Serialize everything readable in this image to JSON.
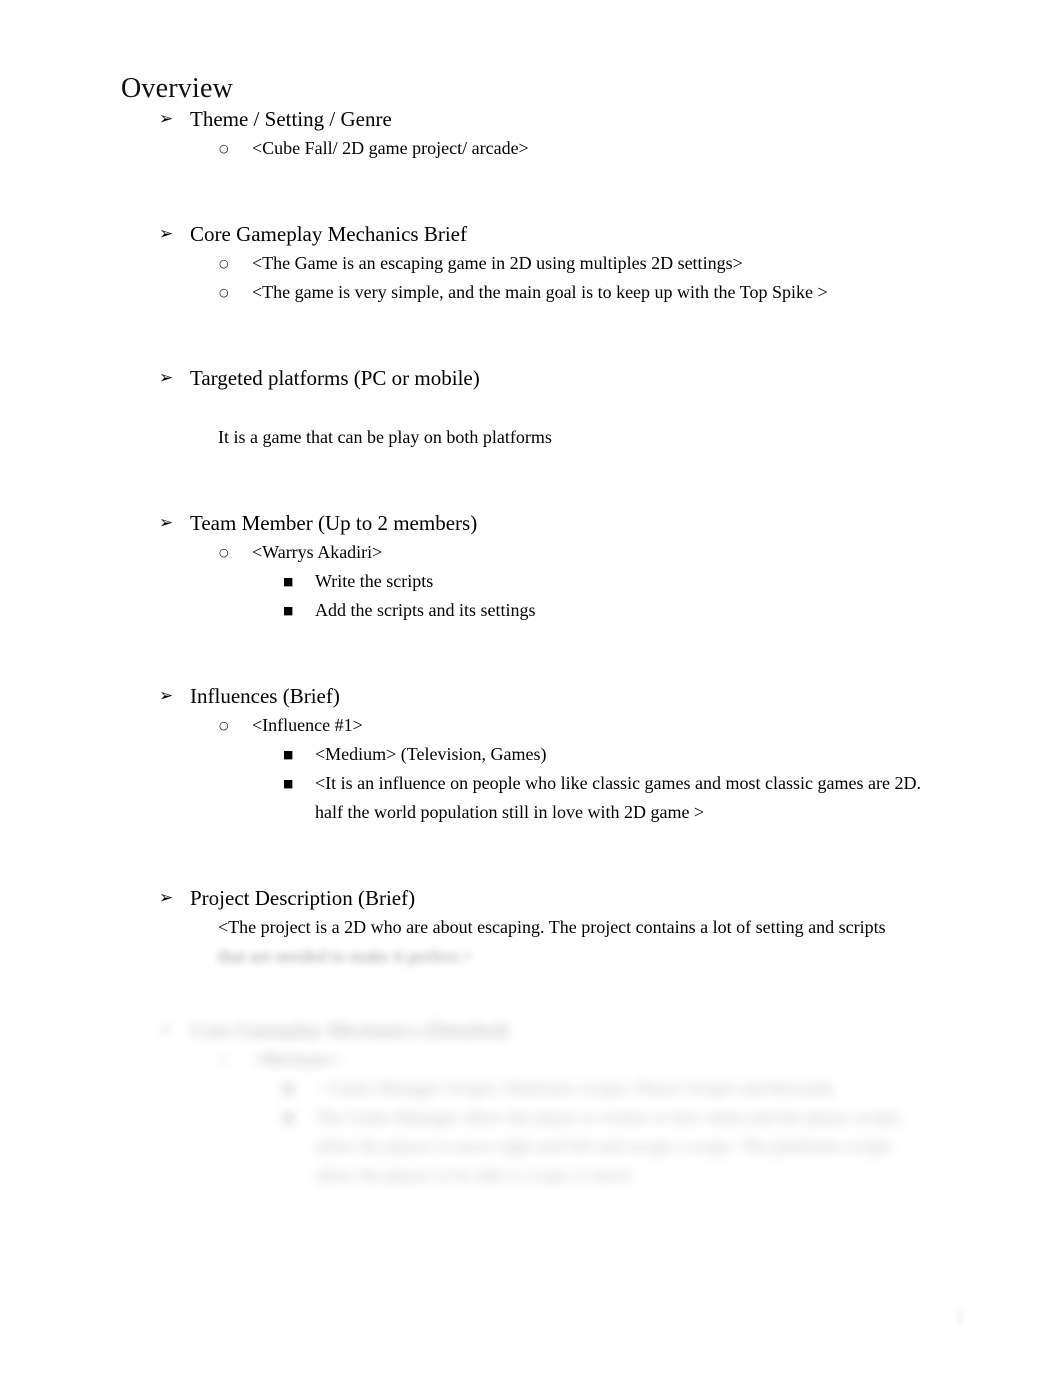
{
  "document": {
    "title": "Overview",
    "page_number": "1",
    "bullet_glyphs": {
      "level1": "➢",
      "level2": "○",
      "level3": "■"
    },
    "sections": [
      {
        "heading": "Theme / Setting / Genre",
        "items": [
          {
            "level": 2,
            "text": "<Cube Fall/ 2D game project/ arcade>"
          }
        ]
      },
      {
        "heading": "Core Gameplay Mechanics Brief",
        "items": [
          {
            "level": 2,
            "text": "<The Game is an escaping game in 2D using multiples 2D settings>"
          },
          {
            "level": 2,
            "text": "<The game is very simple, and the main goal is to keep up with the Top Spike >"
          }
        ]
      },
      {
        "heading": "Targeted platforms (PC or mobile)",
        "items": [
          {
            "level": 0,
            "text": "It is a game that can be play on both platforms"
          }
        ]
      },
      {
        "heading": "Team Member (Up to 2 members)",
        "items": [
          {
            "level": 2,
            "text": "<Warrys Akadiri>"
          },
          {
            "level": 3,
            "text": "Write the scripts"
          },
          {
            "level": 3,
            "text": "Add the scripts and its settings"
          }
        ]
      },
      {
        "heading": "Influences (Brief)",
        "items": [
          {
            "level": 2,
            "text": "<Influence #1>"
          },
          {
            "level": 3,
            "text": "<Medium> (Television, Games)"
          },
          {
            "level": 3,
            "text": "<It is an influence on people who like classic games and most classic games are 2D. half the world population still in love with 2D game >"
          }
        ]
      },
      {
        "heading": "Project Description (Brief)",
        "items": [
          {
            "level": 0,
            "text": "<The project is a 2D who are about escaping. The project contains a lot of setting and scripts"
          },
          {
            "level": 0,
            "text": "that are needed to make it perfect.>"
          }
        ]
      },
      {
        "heading": "Core Gameplay Mechanics (Detailed)",
        "items": [
          {
            "level": 2,
            "text": "<Mechanic>"
          },
          {
            "level": 3,
            "text": "< Game Manager Scripts, Platforms scripts, Player Scripts and Rewards"
          },
          {
            "level": 3,
            "text": "The Game Manager allow the player to restart or lose when and the player scripts allow the player to move right and left and escape a scape. The platforms scripts allow the player to be able to scape or move"
          }
        ]
      }
    ]
  }
}
